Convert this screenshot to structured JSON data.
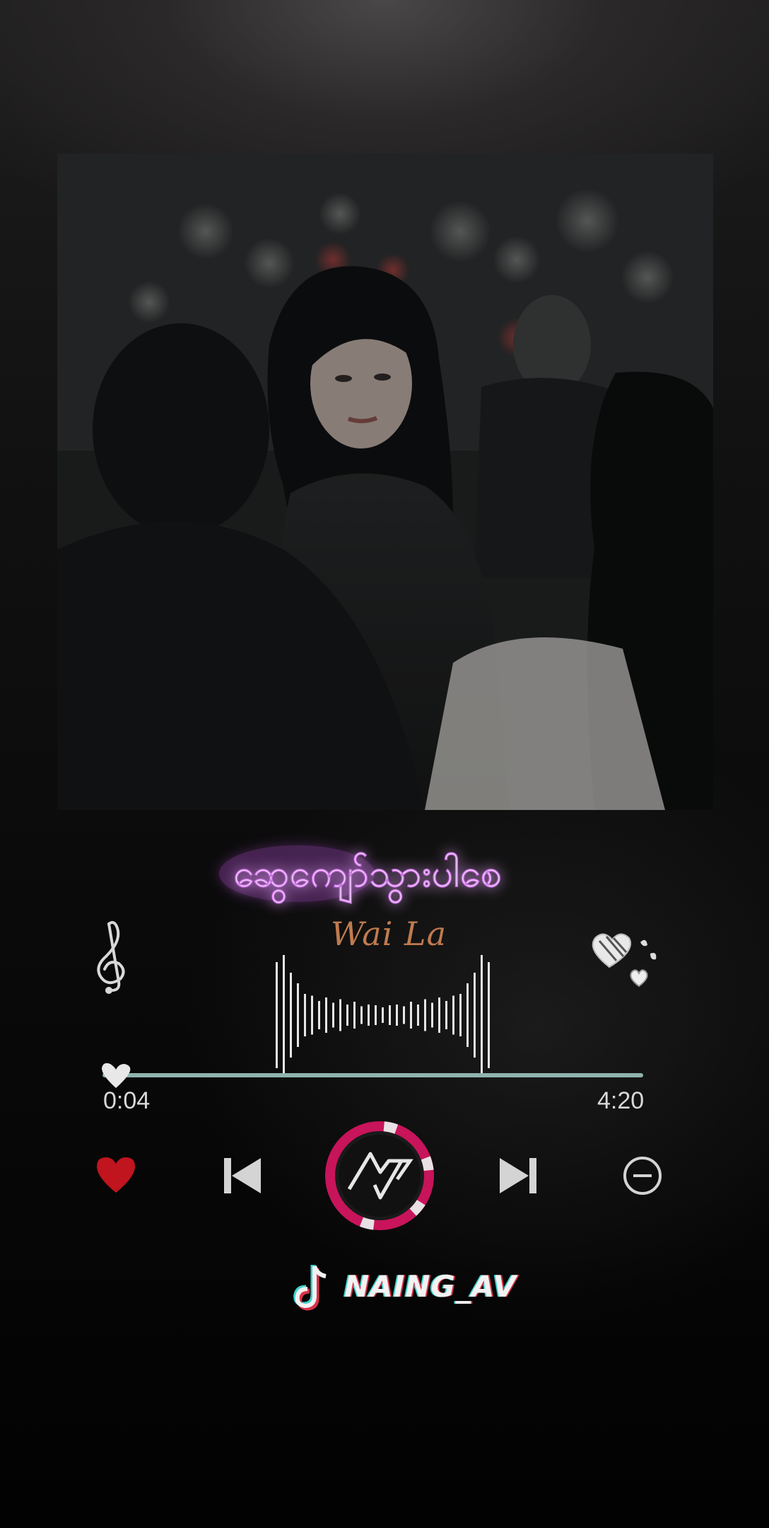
{
  "song": {
    "title": "ဆွေကျော်သွားပါစေ",
    "artist": "Wai La"
  },
  "playback": {
    "current_time": "0:04",
    "total_time": "4:20",
    "progress_fraction": 0.015
  },
  "controls": {
    "like_icon": "heart-icon",
    "prev_icon": "skip-previous-icon",
    "play_icon": "play-logo-icon",
    "next_icon": "skip-next-icon",
    "remove_icon": "minus-circle-icon"
  },
  "brand": {
    "handle": "NAING_AV",
    "platform_icon": "tiktok-icon"
  },
  "colors": {
    "like": "#c0141e",
    "progress_track": "#8fb3ad",
    "play_ring": "#c8145a",
    "artist": "#c07a4f",
    "title_glow": "#c86be0"
  }
}
